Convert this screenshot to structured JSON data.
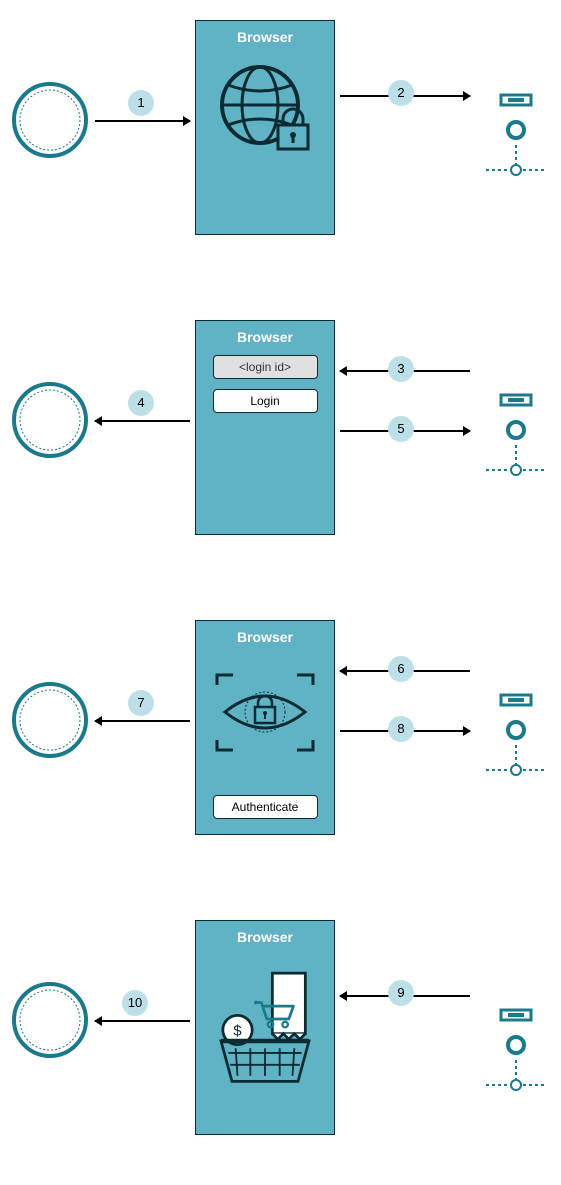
{
  "panels": [
    {
      "browser_title": "Browser",
      "left_badge": "1",
      "right_top_badge": "2",
      "right_bottom_badge": null,
      "content": "globe-lock"
    },
    {
      "browser_title": "Browser",
      "left_badge": "4",
      "right_top_badge": "3",
      "right_bottom_badge": "5",
      "content": "login-form",
      "login_field_value": "<login id>",
      "login_button_label": "Login"
    },
    {
      "browser_title": "Browser",
      "left_badge": "7",
      "right_top_badge": "6",
      "right_bottom_badge": "8",
      "content": "eye-lock",
      "auth_button_label": "Authenticate"
    },
    {
      "browser_title": "Browser",
      "left_badge": "10",
      "right_top_badge": "9",
      "right_bottom_badge": null,
      "content": "shopping"
    }
  ],
  "colors": {
    "panel": "#5fb3c4",
    "accent": "#1a7a8c",
    "badge": "#bde0e8"
  }
}
